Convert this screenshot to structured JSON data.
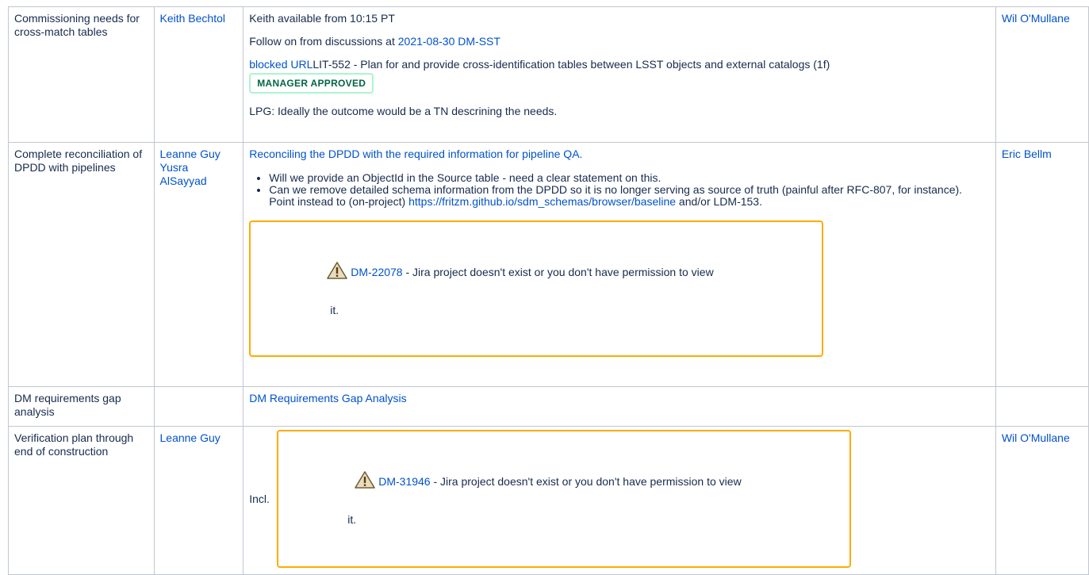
{
  "rows": [
    {
      "topic": "Commissioning needs for cross-match tables",
      "requester": "Keith Bechtol",
      "notes": {
        "line1": "Keith available from 10:15 PT",
        "line2_prefix": "Follow on from discussions at ",
        "line2_link": "2021-08-30 DM-SST",
        "blocked_url": "blocked URL",
        "lit_text": "LIT-552 - Plan for and provide cross-identification tables between LSST objects and external catalogs (1f)",
        "status": "MANAGER APPROVED",
        "lpg": "LPG: Ideally the outcome would be a TN descrining the needs."
      },
      "owner": "Wil O'Mullane"
    },
    {
      "topic": "Complete reconciliation of DPDD with pipelines",
      "requester_1": "Leanne Guy",
      "requester_2": "Yusra AlSayyad",
      "notes": {
        "intro": "Reconciling the DPDD with the required information for pipeline QA.",
        "bullet1": "Will we provide an ObjectId in the Source table - need a clear statement on this.",
        "bullet2_a": "Can we remove detailed schema information from the DPDD so it is no longer serving as source of truth (painful after RFC-807, for instance).  Point instead to (on-project) ",
        "bullet2_link": "https://fritzm.github.io/sdm_schemas/browser/baseline",
        "bullet2_b": " and/or LDM-153.",
        "jira_key": "DM-22078",
        "jira_msg": " - Jira project doesn't exist or you don't have permission to view",
        "jira_msg2": "it."
      },
      "owner": "Eric Bellm"
    },
    {
      "topic": "DM requirements gap analysis",
      "requester": "",
      "notes": {
        "link": "DM Requirements Gap Analysis"
      },
      "owner": ""
    },
    {
      "topic": "Verification plan through end of construction",
      "requester": "Leanne Guy",
      "notes": {
        "incl": "Incl.",
        "jira_key": "DM-31946",
        "jira_msg": " - Jira project doesn't exist or you don't have permission to view",
        "jira_msg2": "it."
      },
      "owner": "Wil O'Mullane"
    }
  ],
  "icons": {
    "warning": "warning-triangle-icon"
  },
  "colors": {
    "link": "#0052cc",
    "lozenge_border": "#abf5d1",
    "lozenge_text": "#006644",
    "jira_border": "#ffab00"
  }
}
